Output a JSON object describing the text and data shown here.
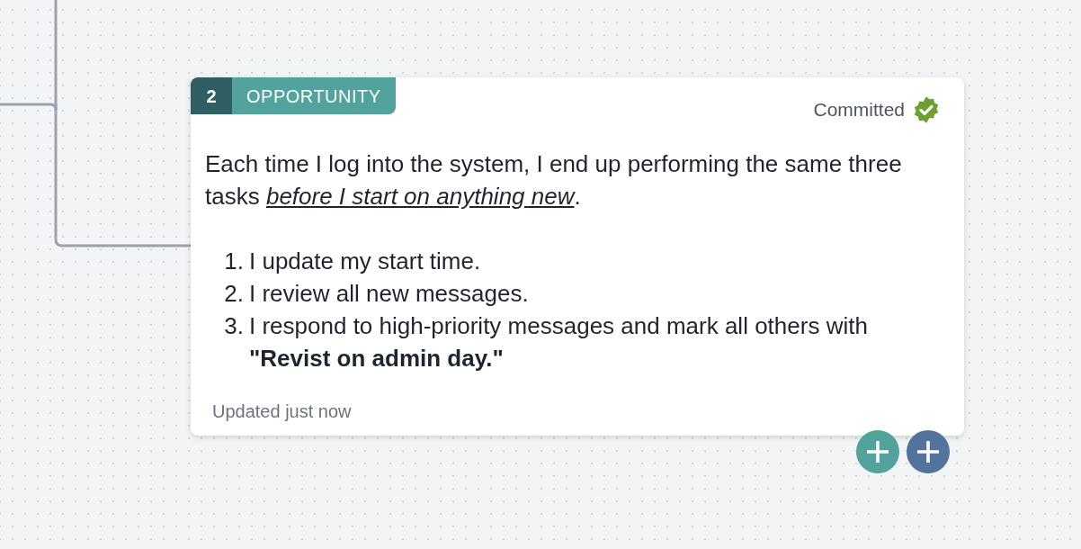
{
  "card": {
    "number": "2",
    "type": "OPPORTUNITY",
    "status": "Committed",
    "committed": true,
    "intro": "Each time I log into the system, I end up performing the same three tasks *before I start on anything new*.",
    "steps": [
      {
        "number": "1.",
        "text": "I update my start time."
      },
      {
        "number": "2.",
        "text": "I review all new messages."
      },
      {
        "number": "3.",
        "text": "I respond to high-priority messages and mark all others with **\"Revist on admin day.\"**"
      }
    ],
    "updated": "Updated just now"
  },
  "add_buttons": [
    {
      "color": "#52a39c"
    },
    {
      "color": "#51739c"
    }
  ]
}
